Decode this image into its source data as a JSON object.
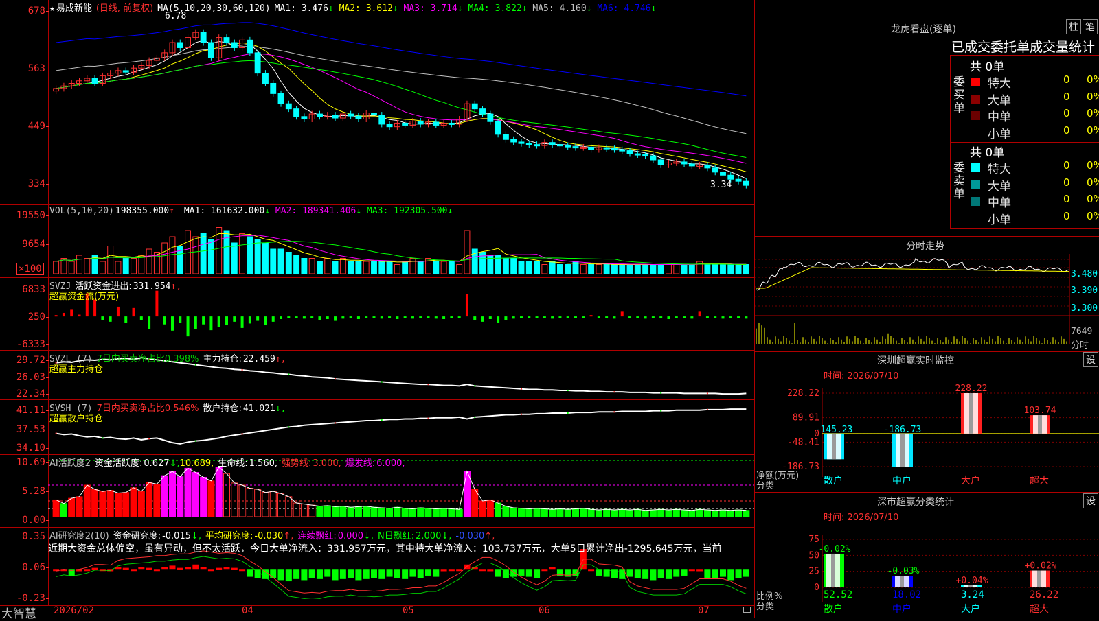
{
  "stock": {
    "name": "易成新能",
    "mode": "(日线, 前复权)",
    "star": "★"
  },
  "kline": {
    "ma_label": "MA(5,10,20,30,60,120)",
    "ma": [
      {
        "name": "MA1:",
        "value": "3.476",
        "arrow": "↓",
        "color": "#ffffff"
      },
      {
        "name": "MA2:",
        "value": "3.612",
        "arrow": "↓",
        "color": "#ffff00"
      },
      {
        "name": "MA3:",
        "value": "3.714",
        "arrow": "↓",
        "color": "#ff00ff"
      },
      {
        "name": "MA4:",
        "value": "3.822",
        "arrow": "↓",
        "color": "#00ff00"
      },
      {
        "name": "MA5:",
        "value": "4.160",
        "arrow": "↓",
        "color": "#c0c0c0"
      },
      {
        "name": "MA6:",
        "value": "4.746",
        "arrow": "↓",
        "color": "#0000ff"
      }
    ],
    "yticks": [
      "678",
      "563",
      "449",
      "334"
    ],
    "high_label": "6.78",
    "low_label": "3.34",
    "close": [
      5.3,
      5.35,
      5.4,
      5.45,
      5.5,
      5.4,
      5.55,
      5.6,
      5.65,
      5.62,
      5.7,
      5.75,
      5.85,
      5.9,
      6.0,
      6.2,
      6.1,
      6.3,
      6.4,
      6.2,
      5.9,
      6.3,
      6.2,
      6.1,
      6.25,
      6.0,
      5.6,
      5.4,
      5.2,
      5.0,
      4.9,
      4.75,
      4.7,
      4.8,
      4.75,
      4.78,
      4.72,
      4.8,
      4.76,
      4.7,
      4.82,
      4.78,
      4.6,
      4.55,
      4.62,
      4.58,
      4.66,
      4.6,
      4.64,
      4.58,
      4.62,
      4.6,
      4.7,
      5.0,
      4.9,
      4.8,
      4.65,
      4.4,
      4.3,
      4.25,
      4.22,
      4.2,
      4.18,
      4.24,
      4.2,
      4.18,
      4.16,
      4.14,
      4.15,
      4.1,
      4.14,
      4.12,
      4.1,
      4.08,
      4.02,
      4.0,
      3.98,
      3.9,
      3.8,
      3.84,
      3.86,
      3.82,
      3.78,
      3.8,
      3.74,
      3.66,
      3.6,
      3.52,
      3.48,
      3.4
    ]
  },
  "vol": {
    "label": "VOL(5,10,20)",
    "value": "198355.000",
    "value_arrow": "↑",
    "ma": [
      {
        "name": "MA1:",
        "value": "161632.000",
        "arrow": "↓",
        "color": "#ffffff"
      },
      {
        "name": "MA2:",
        "value": "189341.406",
        "arrow": "↓",
        "color": "#ff00ff"
      },
      {
        "name": "MA3:",
        "value": "192305.500",
        "arrow": "↓",
        "color": "#00ff00"
      }
    ],
    "yticks": [
      "19550",
      "9654"
    ],
    "unit": "×100",
    "values": [
      4,
      5,
      4,
      6,
      5,
      6,
      4,
      9,
      4,
      5,
      5,
      6,
      8,
      7,
      10,
      12,
      9,
      14,
      12,
      13,
      11,
      15,
      14,
      10,
      13,
      12,
      11,
      10,
      8,
      8,
      7,
      6,
      5,
      5,
      4,
      5,
      4,
      5,
      4,
      4,
      4,
      4,
      4,
      4,
      3,
      4,
      5,
      4,
      5,
      4,
      4,
      4,
      3,
      14,
      8,
      7,
      6,
      6,
      5,
      5,
      4,
      4,
      4,
      3,
      4,
      3,
      3,
      4,
      3,
      3,
      3,
      3,
      3,
      3,
      3,
      3,
      3,
      3,
      3,
      3,
      3,
      3,
      3,
      4,
      3,
      3,
      3,
      3,
      3,
      3
    ]
  },
  "svzj": {
    "label": "SVZJ",
    "name": "活跃资金进出:",
    "value": "331.954",
    "arrow": "↑,",
    "sub": "超赢资金流(万元)",
    "yticks": [
      "6833",
      "250",
      "-6333"
    ],
    "values": [
      300,
      800,
      1500,
      400,
      5200,
      3800,
      -800,
      -1200,
      2200,
      -1500,
      1900,
      -900,
      -2800,
      5800,
      -1800,
      -3200,
      -1400,
      -4500,
      -2800,
      -1800,
      -3100,
      -2400,
      -2000,
      -1200,
      -2600,
      -1600,
      -1000,
      -2000,
      -1200,
      -600,
      -400,
      -300,
      -500,
      -400,
      -800,
      -600,
      -1000,
      -500,
      -300,
      -600,
      -400,
      -300,
      -500,
      -400,
      -600,
      -300,
      -500,
      -400,
      -300,
      -500,
      -600,
      -300,
      -400,
      5100,
      -800,
      -1200,
      -600,
      -1500,
      -800,
      -500,
      -400,
      -300,
      -400,
      -300,
      -500,
      -400,
      -300,
      -400,
      -300,
      300,
      -400,
      -300,
      -500,
      1200,
      -400,
      -300,
      -500,
      -400,
      -300,
      -600,
      -400,
      -300,
      -500,
      1200,
      -400,
      -300,
      -500,
      -400,
      -300,
      -500
    ]
  },
  "svzl": {
    "label": "SVZL (7)",
    "desc": "7日内买卖净占比0.398%",
    "name": "主力持仓:",
    "value": "22.459",
    "arrow": "↑,",
    "sub": "超赢主力持仓",
    "yticks": [
      "29.72",
      "26.03",
      "22.34"
    ],
    "values": [
      28.6,
      28.8,
      28.7,
      29.0,
      29.2,
      29.1,
      29.3,
      29.2,
      29.4,
      29.5,
      29.3,
      29.6,
      29.4,
      29.2,
      29.0,
      28.8,
      28.6,
      28.4,
      28.2,
      28.0,
      27.8,
      27.6,
      27.5,
      27.3,
      27.2,
      27.0,
      26.9,
      26.7,
      26.6,
      26.4,
      26.3,
      26.1,
      26.0,
      25.8,
      25.7,
      25.6,
      25.4,
      25.3,
      25.2,
      25.1,
      25.0,
      24.9,
      24.8,
      24.7,
      24.6,
      24.5,
      24.4,
      24.3,
      24.3,
      24.2,
      24.1,
      24.1,
      24.0,
      24.3,
      24.0,
      23.9,
      23.8,
      23.7,
      23.6,
      23.5,
      23.4,
      23.3,
      23.3,
      23.2,
      23.2,
      23.1,
      23.1,
      23.0,
      23.0,
      22.9,
      22.9,
      22.8,
      22.8,
      22.8,
      22.7,
      22.7,
      22.7,
      22.6,
      22.6,
      22.6,
      22.6,
      22.5,
      22.5,
      22.5,
      22.5,
      22.5,
      22.4,
      22.4,
      22.4,
      22.5
    ]
  },
  "svsh": {
    "label": "SVSH (7)",
    "desc": "7日内买卖净占比0.546%",
    "name": "散户持仓:",
    "value": "41.021",
    "arrow": "↓,",
    "sub": "超赢散户持仓",
    "yticks": [
      "41.11",
      "37.53",
      "34.10"
    ],
    "values": [
      36.8,
      36.6,
      36.7,
      36.4,
      36.2,
      36.3,
      36.0,
      36.1,
      35.9,
      35.8,
      36.0,
      35.7,
      35.9,
      36.0,
      35.6,
      35.2,
      35.0,
      35.3,
      35.5,
      35.6,
      35.8,
      36.0,
      36.3,
      36.5,
      36.7,
      36.9,
      37.1,
      37.3,
      37.5,
      37.7,
      37.9,
      38.0,
      38.2,
      38.3,
      38.4,
      38.5,
      38.6,
      38.7,
      38.8,
      38.9,
      39.0,
      39.0,
      39.1,
      39.2,
      39.2,
      39.3,
      39.3,
      39.4,
      39.4,
      39.5,
      39.5,
      39.5,
      39.6,
      39.3,
      39.6,
      39.7,
      39.8,
      39.9,
      40.0,
      40.0,
      40.1,
      40.1,
      40.2,
      40.2,
      40.3,
      40.3,
      40.3,
      40.4,
      40.4,
      40.4,
      40.5,
      40.5,
      40.5,
      40.6,
      40.6,
      40.6,
      40.6,
      40.7,
      40.7,
      40.7,
      40.8,
      40.8,
      40.8,
      40.8,
      40.9,
      40.9,
      40.9,
      41.0,
      41.0,
      41.0
    ]
  },
  "ai2": {
    "label": "AI活跃度2",
    "name": "资金活跃度:",
    "value": "0.627",
    "arrow": "↓,",
    "v2": "10.689,",
    "life_name": "生命线:",
    "life": "1.560,",
    "strong_name": "强势线:",
    "strong": "3.000,",
    "burst_name": "爆发线:",
    "burst": "6.000,",
    "yticks": [
      "10.69",
      "5.28",
      "0.00"
    ],
    "values": [
      3.2,
      2.5,
      3.5,
      3.8,
      6.0,
      5.2,
      4.8,
      5.0,
      4.5,
      4.6,
      5.5,
      4.8,
      6.5,
      6.2,
      7.8,
      8.6,
      7.6,
      9.2,
      8.4,
      7.5,
      6.8,
      9.4,
      8.2,
      6.4,
      6.0,
      5.4,
      5.2,
      4.6,
      4.8,
      4.4,
      3.8,
      2.6,
      2.4,
      2.2,
      2.0,
      2.1,
      1.9,
      2.0,
      1.8,
      1.9,
      2.0,
      1.8,
      1.7,
      1.6,
      1.8,
      1.6,
      1.5,
      1.7,
      1.6,
      1.5,
      1.6,
      1.5,
      1.4,
      8.6,
      5.2,
      3.0,
      3.2,
      2.6,
      2.0,
      1.7,
      1.6,
      1.5,
      1.6,
      1.5,
      1.4,
      1.5,
      1.4,
      1.5,
      1.6,
      1.4,
      1.3,
      1.4,
      1.3,
      1.4,
      1.3,
      1.4,
      1.2,
      1.3,
      1.4,
      1.3,
      1.4,
      1.3,
      1.2,
      1.4,
      1.3,
      1.2,
      1.3,
      1.2,
      1.3,
      1.2
    ]
  },
  "ai_research": {
    "label": "AI研究度2(10)",
    "name": "资金研究度:",
    "value": "-0.015",
    "arrow": "↓,",
    "avg_name": "平均研究度:",
    "avg": "-0.030",
    "avg_arrow": "↑,",
    "lian_name": "连续飘红:",
    "lian": "0.000",
    "lian_arrow": "↓,",
    "n_name": "N日飘红:",
    "n": "2.000",
    "n_arrow": "↓,",
    "last": "-0.030",
    "last_arrow": "↑,",
    "yticks": [
      "0.35",
      "0.06",
      "-0.23"
    ],
    "comment": "近期大资金总体偏空，虽有异动，但不太活跃，今日大单净流入：331.957万元，其中特大单净流入：103.737万元，大单5日累计净出-1295.645万元，当前",
    "values": [
      0.04,
      0.03,
      -0.02,
      0.02,
      0.03,
      0.05,
      0.04,
      0.02,
      0.06,
      0.05,
      0.04,
      0.06,
      0.05,
      0.04,
      0.06,
      0.07,
      0.05,
      0.06,
      0.08,
      0.06,
      0.04,
      0.05,
      0.06,
      0.05,
      0.04,
      -0.03,
      -0.04,
      -0.05,
      -0.04,
      -0.06,
      -0.07,
      -0.05,
      -0.06,
      -0.04,
      -0.05,
      -0.03,
      -0.06,
      -0.05,
      -0.04,
      -0.06,
      -0.05,
      -0.04,
      -0.05,
      -0.03,
      -0.04,
      -0.05,
      -0.03,
      -0.04,
      -0.02,
      -0.03,
      0.02,
      0.03,
      0.04,
      0.08,
      0.06,
      0.04,
      0.02,
      -0.03,
      -0.04,
      -0.03,
      -0.02,
      -0.03,
      -0.04,
      0.03,
      0.06,
      -0.02,
      -0.03,
      -0.02,
      0.22,
      0.03,
      -0.02,
      -0.03,
      -0.04,
      -0.05,
      -0.03,
      -0.04,
      -0.05,
      -0.06,
      -0.04,
      -0.05,
      -0.03,
      -0.02,
      0.03,
      0.02,
      -0.04,
      -0.05,
      -0.03,
      -0.06,
      -0.04,
      -0.03
    ]
  },
  "xaxis": {
    "brand": "大智慧",
    "labels": [
      "2026/02",
      "04",
      "05",
      "06",
      "07"
    ]
  },
  "lhb": {
    "title": "龙虎看盘(逐单)",
    "btn1": "柱",
    "btn2": "笔",
    "tabs": "已成交委托单成交量统计",
    "buy": {
      "side": "委买单",
      "total": "共 0单",
      "rows": [
        {
          "name": "特大",
          "v1": "0",
          "v2": "0%",
          "color": "#ff0000"
        },
        {
          "name": "大单",
          "v1": "0",
          "v2": "0%",
          "color": "#8b0000"
        },
        {
          "name": "中单",
          "v1": "0",
          "v2": "0%",
          "color": "#6b0000"
        },
        {
          "name": "小单",
          "v1": "0",
          "v2": "0%",
          "color": "#000000"
        }
      ]
    },
    "sell": {
      "side": "委卖单",
      "total": "共 0单",
      "rows": [
        {
          "name": "特大",
          "v1": "0",
          "v2": "0%",
          "color": "#00ffff"
        },
        {
          "name": "大单",
          "v1": "0",
          "v2": "0%",
          "color": "#009999"
        },
        {
          "name": "中单",
          "v1": "0",
          "v2": "0%",
          "color": "#007777"
        },
        {
          "name": "小单",
          "v1": "0",
          "v2": "0%",
          "color": "#000000"
        }
      ]
    }
  },
  "intraday": {
    "title": "分时走势",
    "prices": [
      "3.480",
      "3.390",
      "3.300"
    ],
    "vol": "7649",
    "vol_unit": "分时"
  },
  "monitor": {
    "title": "深圳超赢实时监控",
    "btn": "设",
    "time": "时间: 2026/07/10",
    "yticks": [
      "228.22",
      "89.91",
      "0",
      "-48.41",
      "-186.73"
    ],
    "ylabel1": "净额(万元)",
    "ylabel2": "分类",
    "bars": [
      {
        "cat": "散户",
        "value": -145.23,
        "label": "-145.23"
      },
      {
        "cat": "中户",
        "value": -186.73,
        "label": "-186.73"
      },
      {
        "cat": "大户",
        "value": 228.22,
        "label": "228.22"
      },
      {
        "cat": "超大",
        "value": 103.74,
        "label": "103.74"
      }
    ]
  },
  "classify": {
    "title": "深市超赢分类统计",
    "btn": "设",
    "time": "时间: 2026/07/10",
    "yticks": [
      "75",
      "50",
      "25",
      "0"
    ],
    "ylabel1": "比例%",
    "ylabel2": "分类",
    "bars": [
      {
        "cat": "散户",
        "value": 52.52,
        "label": "52.52",
        "delta": "-0.02%"
      },
      {
        "cat": "中户",
        "value": 18.02,
        "label": "18.02",
        "delta": "-0.03%"
      },
      {
        "cat": "大户",
        "value": 3.24,
        "label": "3.24",
        "delta": "+0.04%"
      },
      {
        "cat": "超大",
        "value": 26.22,
        "label": "26.22",
        "delta": "+0.02%"
      }
    ]
  }
}
